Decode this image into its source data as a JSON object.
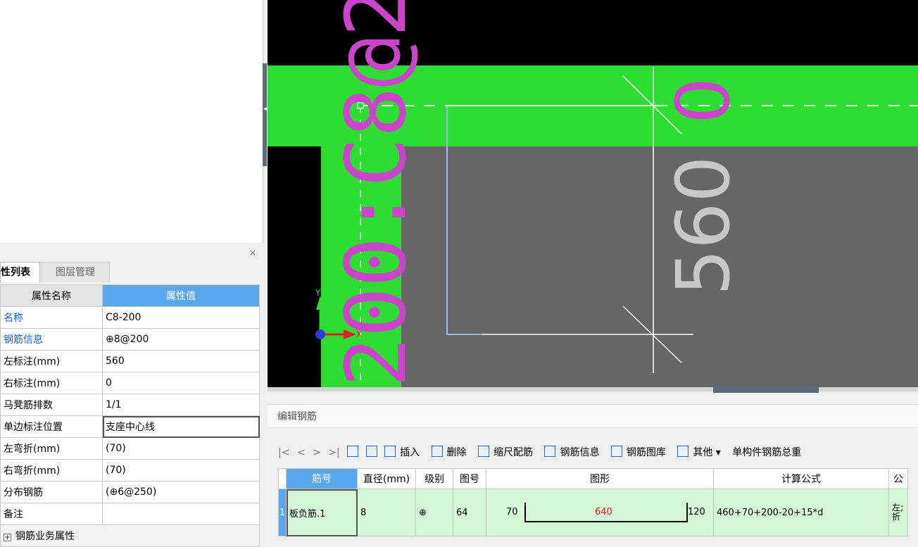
{
  "properties_panel": {
    "close_glyph": "×",
    "tabs": [
      "性列表",
      "图层管理"
    ],
    "header": {
      "name": "属性名称",
      "value": "属性值"
    },
    "rows": [
      {
        "name": "名称",
        "value": "C8-200",
        "blue": true
      },
      {
        "name": "钢筋信息",
        "value": "⊕8@200",
        "blue": true
      },
      {
        "name": "左标注(mm)",
        "value": "560"
      },
      {
        "name": "右标注(mm)",
        "value": "0"
      },
      {
        "name": "马凳筋排数",
        "value": "1/1"
      },
      {
        "name": "单边标注位置",
        "value": "支座中心线"
      },
      {
        "name": "左弯折(mm)",
        "value": "(70)"
      },
      {
        "name": "右弯折(mm)",
        "value": "(70)"
      },
      {
        "name": "分布钢筋",
        "value": "(⊕6@250)"
      },
      {
        "name": "备注",
        "value": ""
      }
    ],
    "group_row": {
      "plus": "+",
      "label": "钢筋业务属性"
    }
  },
  "canvas": {
    "rebar_label": "200:C8@2",
    "dim_label_vertical": "560",
    "dim_label_top": "0",
    "axis_y": "Y",
    "axis_x": "X",
    "colors": {
      "background": "#000000",
      "slab_green": "#2ddd31",
      "gray_fill": "#666666",
      "magenta": "#cc44cc"
    }
  },
  "rebar_editor": {
    "title": "编辑钢筋",
    "toolbar": {
      "nav": [
        "|<",
        "<",
        ">",
        ">|"
      ],
      "items": [
        "插入",
        "删除",
        "缩尺配筋",
        "钢筋信息",
        "钢筋图库",
        "其他 ▾",
        "单构件钢筋总重"
      ]
    },
    "columns": [
      "筋号",
      "直径(mm)",
      "级别",
      "图号",
      "图形",
      "计算公式",
      "公"
    ],
    "rows": [
      {
        "index": "1",
        "bar_no": "板负筋.1",
        "diameter": "8",
        "grade": "⊕",
        "shape_no": "64",
        "shape_left": "70",
        "shape_mid": "640",
        "shape_right": "120",
        "formula": "460+70+200-20+15*d",
        "desc": "左;折"
      }
    ]
  }
}
